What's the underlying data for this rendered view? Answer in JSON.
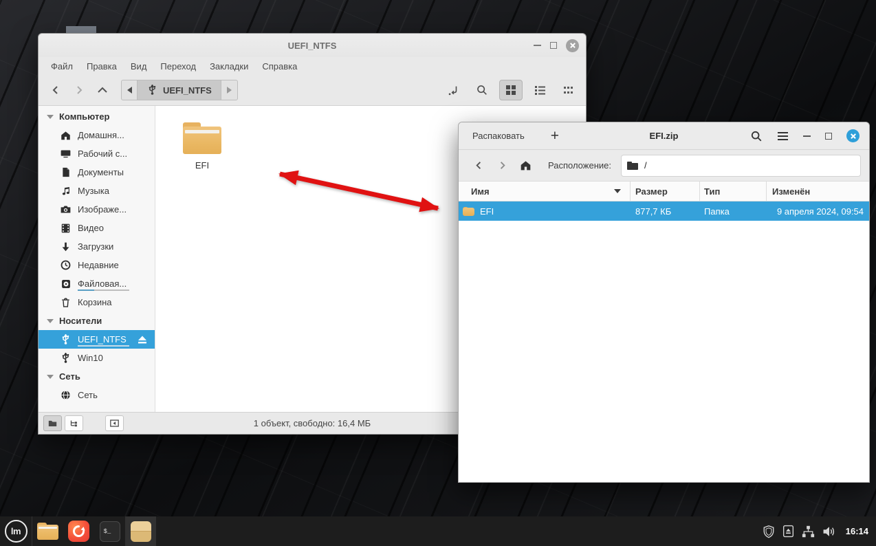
{
  "colors": {
    "accent": "#35a1da",
    "selection": "#35a1da",
    "arrow": "#e01212",
    "taskbar": "#1d1d1d",
    "folder": "#eab863"
  },
  "nemo": {
    "title": "UEFI_NTFS",
    "menu": {
      "file": "Файл",
      "edit": "Правка",
      "view": "Вид",
      "go": "Переход",
      "bookmarks": "Закладки",
      "help": "Справка"
    },
    "breadcrumb": {
      "label": "UEFI_NTFS"
    },
    "sidebar": {
      "sections": {
        "computer": "Компьютер",
        "devices": "Носители",
        "network": "Сеть"
      },
      "computer_items": [
        {
          "label": "Домашня...",
          "icon": "home-icon"
        },
        {
          "label": "Рабочий с...",
          "icon": "desktop-icon"
        },
        {
          "label": "Документы",
          "icon": "document-icon"
        },
        {
          "label": "Музыка",
          "icon": "music-icon"
        },
        {
          "label": "Изображе...",
          "icon": "camera-icon"
        },
        {
          "label": "Видео",
          "icon": "film-icon"
        },
        {
          "label": "Загрузки",
          "icon": "download-icon"
        },
        {
          "label": "Недавние",
          "icon": "clock-icon"
        },
        {
          "label": "Файловая...",
          "icon": "harddisk-icon"
        },
        {
          "label": "Корзина",
          "icon": "trash-icon"
        }
      ],
      "device_items": [
        {
          "label": "UEFI_NTFS",
          "icon": "usb-icon",
          "selected": true
        },
        {
          "label": "Win10",
          "icon": "usb-icon",
          "selected": false
        }
      ],
      "network_items": [
        {
          "label": "Сеть",
          "icon": "globe-icon"
        }
      ]
    },
    "content": {
      "folder_name": "EFI"
    },
    "statusbar": {
      "text": "1 объект, свободно: 16,4 МБ"
    }
  },
  "archive": {
    "title": "EFI.zip",
    "extract_button": "Распаковать",
    "add_button": "+",
    "location_label": "Расположение:",
    "location_value": "/",
    "columns": {
      "name": "Имя",
      "size": "Размер",
      "type": "Тип",
      "modified": "Изменён"
    },
    "row": {
      "name": "EFI",
      "size": "877,7 КБ",
      "type": "Папка",
      "modified": "9 апреля 2024, 09:54"
    }
  },
  "taskbar": {
    "menu_glyph": "lm",
    "terminal_glyph": "$_",
    "clock": "16:14"
  }
}
